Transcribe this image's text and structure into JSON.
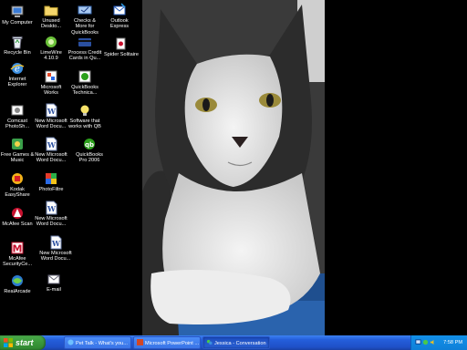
{
  "desktop": {
    "icons_col1": [
      {
        "label": "My Computer",
        "icon": "my-computer-icon"
      },
      {
        "label": "Recycle Bin",
        "icon": "recycle-bin-icon"
      },
      {
        "label": "Internet Explorer",
        "icon": "internet-explorer-icon"
      },
      {
        "label": "Comcast PhotoSh...",
        "icon": "comcast-photoshow-icon"
      },
      {
        "label": "Free Games & Music",
        "icon": "free-games-icon"
      },
      {
        "label": "Kodak EasyShare",
        "icon": "kodak-icon"
      },
      {
        "label": "McAfee Scan",
        "icon": "mcafee-scan-icon"
      },
      {
        "label": "McAfee SecurityCe...",
        "icon": "mcafee-security-icon"
      },
      {
        "label": "RealArcade",
        "icon": "realarcade-icon"
      }
    ],
    "icons_col2": [
      {
        "label": "Unused Deskto...",
        "icon": "folder-icon"
      },
      {
        "label": "LimeWire 4.10.9",
        "icon": "limewire-icon"
      },
      {
        "label": "Microsoft Works",
        "icon": "microsoft-works-icon"
      },
      {
        "label": "New Microsoft Word Docu...",
        "icon": "word-document-icon"
      },
      {
        "label": "New Microsoft Word Docu...",
        "icon": "word-document-icon"
      },
      {
        "label": "PhotoFiltre",
        "icon": "photofiltre-icon"
      },
      {
        "label": "New Microsoft Word Docu...",
        "icon": "word-document-icon"
      },
      {
        "label": "New Microsoft Word Docu...",
        "icon": "word-document-icon"
      },
      {
        "label": "E-mail",
        "icon": "email-icon"
      }
    ],
    "icons_col3": [
      {
        "label": "Checks & More for QuickBooks",
        "icon": "checks-more-icon"
      },
      {
        "label": "Process Credit Cards in Qu...",
        "icon": "credit-cards-icon"
      },
      {
        "label": "QuickBooks Technica...",
        "icon": "quickbooks-tech-icon"
      },
      {
        "label": "Software that works with QB",
        "icon": "software-qb-icon"
      },
      {
        "label": "QuickBooks Pro 2006",
        "icon": "quickbooks-pro-icon"
      }
    ],
    "icons_col4": [
      {
        "label": "Outlook Express",
        "icon": "outlook-express-icon"
      },
      {
        "label": "Spider Solitaire",
        "icon": "spider-solitaire-icon"
      }
    ]
  },
  "taskbar": {
    "start_label": "start",
    "tasks": [
      {
        "label": "Pet Talk - What's you...",
        "icon": "browser-icon"
      },
      {
        "label": "Microsoft PowerPoint ...",
        "icon": "powerpoint-icon"
      },
      {
        "label": "Jessica - Conversation",
        "icon": "messenger-icon"
      }
    ],
    "clock": "7:58 PM"
  },
  "colors": {
    "taskbar": "#245edb",
    "start_button": "#3c9a3c",
    "tray": "#0e7fd8",
    "desktop_background": "#000000"
  }
}
